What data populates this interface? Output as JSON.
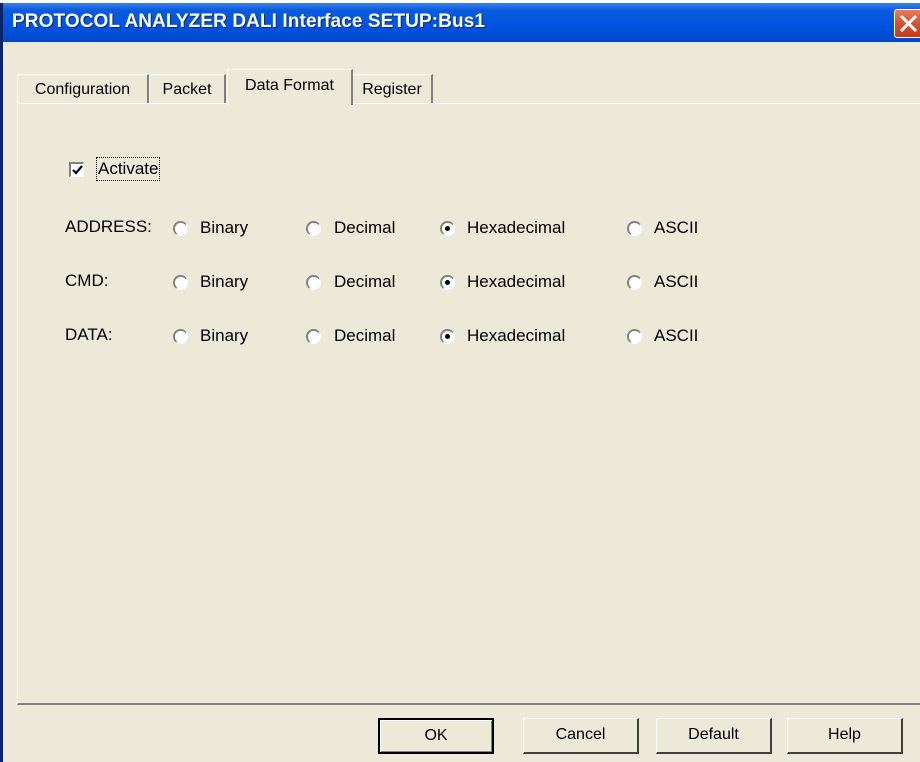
{
  "window": {
    "title": "PROTOCOL ANALYZER DALI Interface SETUP:Bus1",
    "close_icon": "close-x-icon"
  },
  "tabs": [
    {
      "label": "Configuration",
      "active": false
    },
    {
      "label": "Packet",
      "active": false
    },
    {
      "label": "Data Format",
      "active": true
    },
    {
      "label": "Register",
      "active": false
    }
  ],
  "activate": {
    "label": "Activate",
    "checked": true
  },
  "format_options": [
    "Binary",
    "Decimal",
    "Hexadecimal",
    "ASCII"
  ],
  "rows": [
    {
      "label": "ADDRESS:",
      "selected": "Hexadecimal"
    },
    {
      "label": "CMD:",
      "selected": "Hexadecimal"
    },
    {
      "label": "DATA:",
      "selected": "Hexadecimal"
    }
  ],
  "buttons": {
    "ok": "OK",
    "cancel": "Cancel",
    "default": "Default",
    "help": "Help"
  },
  "colors": {
    "titlebar": "#0053e0",
    "dialog_bg": "#ece9d8",
    "close_button": "#d9512c"
  }
}
